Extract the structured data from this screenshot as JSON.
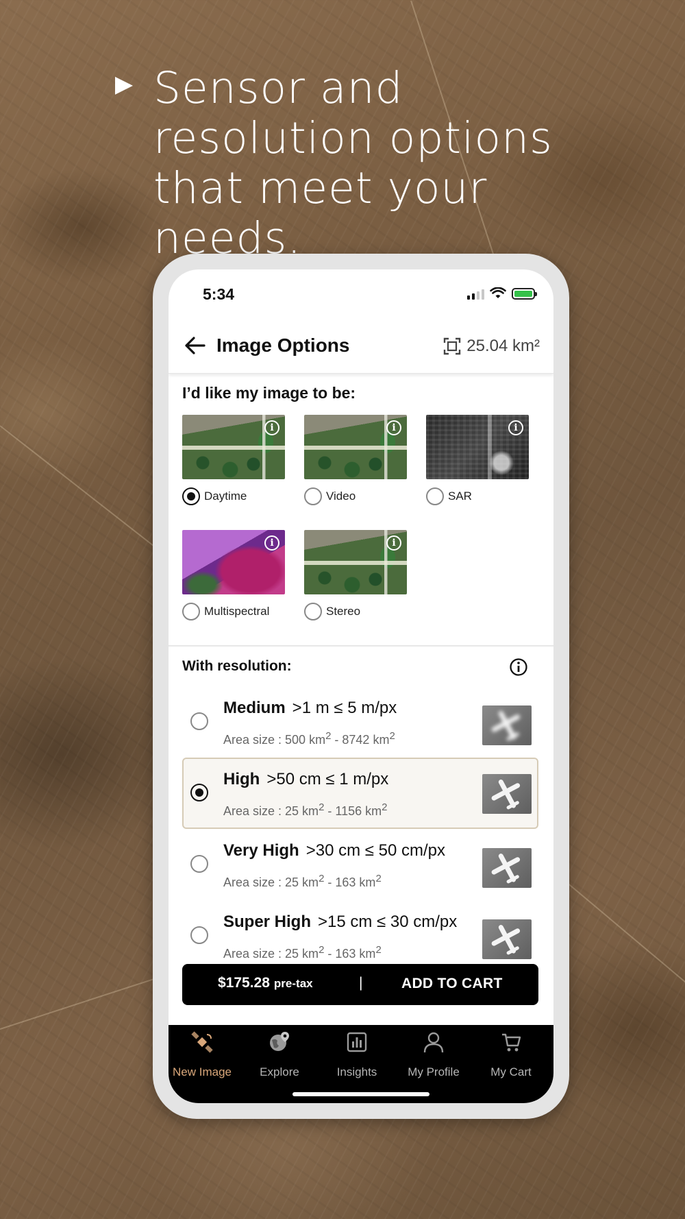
{
  "headline": "Sensor and resolution options that meet your needs.",
  "status_bar": {
    "time": "5:34"
  },
  "app_bar": {
    "title": "Image Options",
    "area": "25.04 km²"
  },
  "image_type": {
    "heading": "I’d like my image to be:",
    "options": [
      {
        "label": "Daytime",
        "selected": true
      },
      {
        "label": "Video",
        "selected": false
      },
      {
        "label": "SAR",
        "selected": false
      },
      {
        "label": "Multispectral",
        "selected": false
      },
      {
        "label": "Stereo",
        "selected": false
      }
    ]
  },
  "resolution": {
    "heading": "With resolution:",
    "options": [
      {
        "name": "Medium",
        "range": ">1 m ≤ 5 m/px",
        "area_prefix": "Area size : 500  km",
        "area_mid": " - 8742  km",
        "selected": false
      },
      {
        "name": "High",
        "range": ">50 cm ≤ 1 m/px",
        "area_prefix": "Area size : 25  km",
        "area_mid": " - 1156  km",
        "selected": true
      },
      {
        "name": "Very High",
        "range": ">30 cm ≤ 50 cm/px",
        "area_prefix": "Area size : 25  km",
        "area_mid": " - 163  km",
        "selected": false
      },
      {
        "name": "Super High",
        "range": ">15 cm ≤ 30 cm/px",
        "area_prefix": "Area size : 25  km",
        "area_mid": " - 163  km",
        "selected": false
      }
    ],
    "superscript": "2"
  },
  "cart_button": {
    "price": "$175.28",
    "pretax": "pre-tax",
    "separator": "|",
    "action": "ADD TO CART"
  },
  "tab_bar": {
    "tabs": [
      {
        "label": "New Image",
        "icon": "satellite-icon",
        "active": true
      },
      {
        "label": "Explore",
        "icon": "globe-pin-icon",
        "active": false
      },
      {
        "label": "Insights",
        "icon": "bar-chart-icon",
        "active": false
      },
      {
        "label": "My Profile",
        "icon": "person-icon",
        "active": false
      },
      {
        "label": "My Cart",
        "icon": "cart-icon",
        "active": false
      }
    ]
  },
  "colors": {
    "accent": "#d9a77a",
    "tab_bar_bg": "#000000",
    "selected_row_bg": "#f8f6f2"
  }
}
